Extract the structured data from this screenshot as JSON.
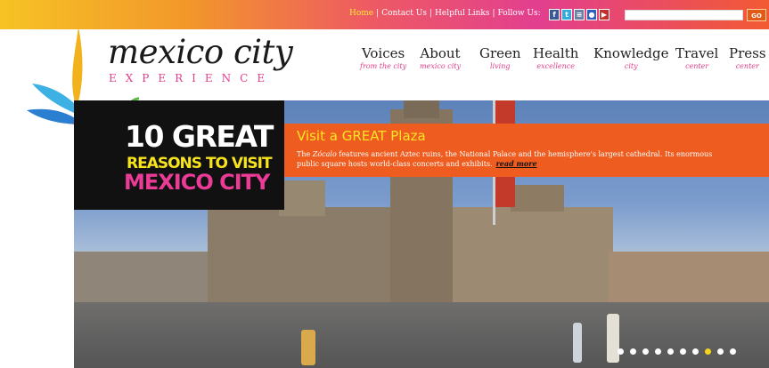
{
  "topnav": {
    "links": [
      "Home",
      "Contact Us",
      "Helpful Links",
      "Follow Us:"
    ],
    "separator": "|",
    "social_icons": [
      {
        "icon": "facebook-icon",
        "glyph": "f",
        "color": "#3b5998"
      },
      {
        "icon": "twitter-icon",
        "glyph": "t",
        "color": "#33aadd"
      },
      {
        "icon": "news-icon",
        "glyph": "≡",
        "color": "#6b7fa8"
      },
      {
        "icon": "flickr-icon",
        "glyph": "●",
        "color": "#2d5fbf"
      },
      {
        "icon": "youtube-icon",
        "glyph": "▶",
        "color": "#c4302b"
      }
    ],
    "search_placeholder": "",
    "go_label": "GO"
  },
  "logo": {
    "title": "mexico city",
    "subtitle": "EXPERIENCE"
  },
  "nav": [
    {
      "label": "Voices",
      "sub": "from the city"
    },
    {
      "label": "About",
      "sub": "mexico city"
    },
    {
      "label": "Green",
      "sub": "living"
    },
    {
      "label": "Health",
      "sub": "excellence"
    },
    {
      "label": "Knowledge",
      "sub": "city"
    },
    {
      "label": "Travel",
      "sub": "center"
    },
    {
      "label": "Press",
      "sub": "center"
    }
  ],
  "promo": {
    "line1": "10 GREAT",
    "line2": "REASONS TO VISIT",
    "line3": "MEXICO CITY",
    "heading": "Visit a GREAT Plaza",
    "desc_italic": "Zócalo",
    "desc_before": "The ",
    "desc_after": " features ancient Aztec ruins, the National Palace and the hemisphere's largest cathedral. Its enormous public square hosts world-class concerts and exhibits.",
    "read_more": "read more"
  },
  "slideshow": {
    "total": 10,
    "active_index": 7
  },
  "colors": {
    "accent_pink": "#e0408a",
    "accent_orange": "#ee5c1f",
    "accent_yellow": "#f9e426"
  }
}
